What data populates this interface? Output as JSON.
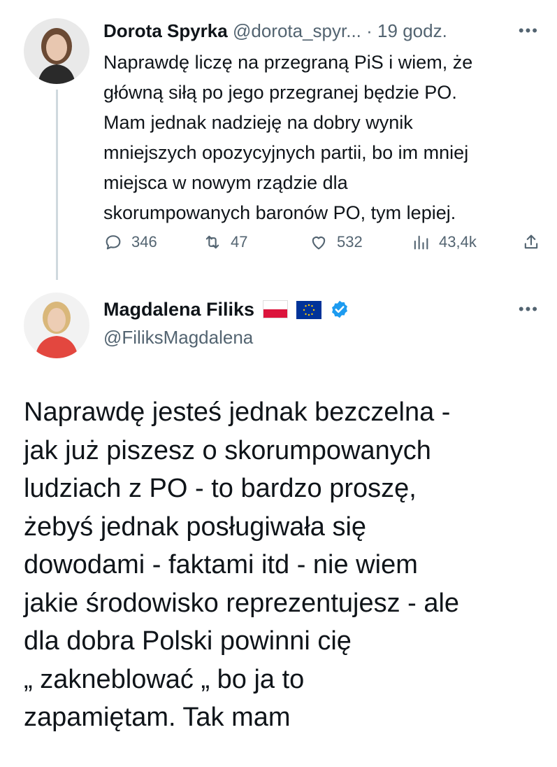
{
  "tweet1": {
    "author_name": "Dorota Spyrka",
    "handle": "@dorota_spyr...",
    "separator": "·",
    "time": "19 godz.",
    "more": "•••",
    "text": "Naprawdę liczę na przegraną PiS i wiem, że\ngłówną siłą po jego przegranej będzie PO.\nMam jednak nadzieję na dobry wynik\nmniejszych opozycyjnych partii, bo im mniej\nmiejsca w nowym rządzie dla\nskorumpowanych baronów PO, tym lepiej.",
    "actions": {
      "replies": "346",
      "retweets": "47",
      "likes": "532",
      "views": "43,4k"
    }
  },
  "tweet2": {
    "author_name": "Magdalena Filiks",
    "handle": "@FiliksMagdalena",
    "more": "•••",
    "badges": [
      "flag-poland",
      "flag-eu",
      "verified-badge"
    ],
    "text": "Naprawdę jesteś jednak bezczelna -\njak już piszesz o skorumpowanych\nludziach z PO - to bardzo proszę,\nżebyś jednak posługiwała się\ndowodami - faktami itd - nie wiem\njakie środowisko reprezentujesz - ale\ndla dobra Polski powinni cię\n„ zakneblować „ bo ja to\nzapamiętam. Tak mam"
  },
  "colors": {
    "text": "#0f1419",
    "secondary": "#536471",
    "thread_line": "#cfd9de",
    "verified": "#1d9bf0"
  }
}
